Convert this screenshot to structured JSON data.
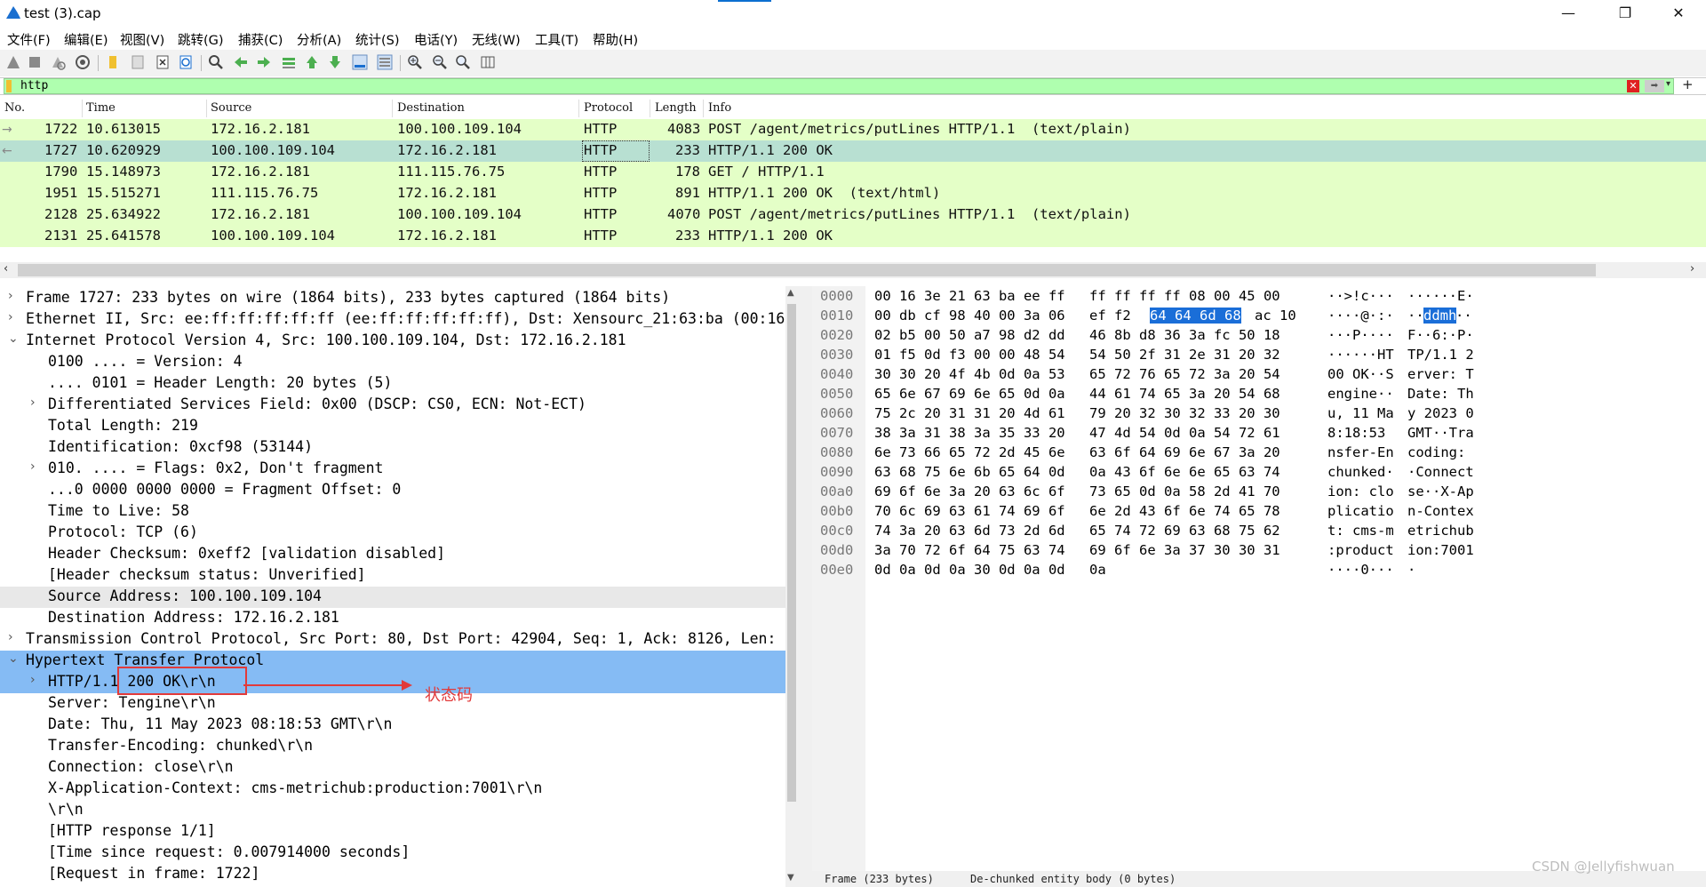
{
  "window": {
    "title": "test (3).cap",
    "minimize": "—",
    "restore": "❐",
    "close": "✕"
  },
  "menu": [
    "文件(F)",
    "编辑(E)",
    "视图(V)",
    "跳转(G)",
    "捕获(C)",
    "分析(A)",
    "统计(S)",
    "电话(Y)",
    "无线(W)",
    "工具(T)",
    "帮助(H)"
  ],
  "filter": {
    "value": "http"
  },
  "packet_list": {
    "columns": [
      "No.",
      "Time",
      "Source",
      "Destination",
      "Protocol",
      "Length",
      "Info"
    ],
    "rows": [
      {
        "no": "1722",
        "time": "10.613015",
        "src": "172.16.2.181",
        "dst": "100.100.109.104",
        "proto": "HTTP",
        "len": "4083",
        "info": "POST /agent/metrics/putLines HTTP/1.1  (text/plain)"
      },
      {
        "no": "1727",
        "time": "10.620929",
        "src": "100.100.109.104",
        "dst": "172.16.2.181",
        "proto": "HTTP",
        "len": "233",
        "info": "HTTP/1.1 200 OK"
      },
      {
        "no": "1790",
        "time": "15.148973",
        "src": "172.16.2.181",
        "dst": "111.115.76.75",
        "proto": "HTTP",
        "len": "178",
        "info": "GET / HTTP/1.1"
      },
      {
        "no": "1951",
        "time": "15.515271",
        "src": "111.115.76.75",
        "dst": "172.16.2.181",
        "proto": "HTTP",
        "len": "891",
        "info": "HTTP/1.1 200 OK  (text/html)"
      },
      {
        "no": "2128",
        "time": "25.634922",
        "src": "172.16.2.181",
        "dst": "100.100.109.104",
        "proto": "HTTP",
        "len": "4070",
        "info": "POST /agent/metrics/putLines HTTP/1.1  (text/plain)"
      },
      {
        "no": "2131",
        "time": "25.641578",
        "src": "100.100.109.104",
        "dst": "172.16.2.181",
        "proto": "HTTP",
        "len": "233",
        "info": "HTTP/1.1 200 OK"
      }
    ]
  },
  "details": [
    {
      "text": "Frame 1727: 233 bytes on wire (1864 bits), 233 bytes captured (1864 bits)",
      "exp": "›",
      "indent": 0
    },
    {
      "text": "Ethernet II, Src: ee:ff:ff:ff:ff:ff (ee:ff:ff:ff:ff:ff), Dst: Xensourc_21:63:ba (00:16",
      "exp": "›",
      "indent": 0
    },
    {
      "text": "Internet Protocol Version 4, Src: 100.100.109.104, Dst: 172.16.2.181",
      "exp": "⌄",
      "indent": 0
    },
    {
      "text": "0100 .... = Version: 4",
      "exp": "",
      "indent": 1
    },
    {
      "text": ".... 0101 = Header Length: 20 bytes (5)",
      "exp": "",
      "indent": 1
    },
    {
      "text": "Differentiated Services Field: 0x00 (DSCP: CS0, ECN: Not-ECT)",
      "exp": "›",
      "indent": 1
    },
    {
      "text": "Total Length: 219",
      "exp": "",
      "indent": 1
    },
    {
      "text": "Identification: 0xcf98 (53144)",
      "exp": "",
      "indent": 1
    },
    {
      "text": "010. .... = Flags: 0x2, Don't fragment",
      "exp": "›",
      "indent": 1
    },
    {
      "text": "...0 0000 0000 0000 = Fragment Offset: 0",
      "exp": "",
      "indent": 1
    },
    {
      "text": "Time to Live: 58",
      "exp": "",
      "indent": 1
    },
    {
      "text": "Protocol: TCP (6)",
      "exp": "",
      "indent": 1
    },
    {
      "text": "Header Checksum: 0xeff2 [validation disabled]",
      "exp": "",
      "indent": 1
    },
    {
      "text": "[Header checksum status: Unverified]",
      "exp": "",
      "indent": 1
    },
    {
      "text": "Source Address: 100.100.109.104",
      "exp": "",
      "indent": 1
    },
    {
      "text": "Destination Address: 172.16.2.181",
      "exp": "",
      "indent": 1
    },
    {
      "text": "Transmission Control Protocol, Src Port: 80, Dst Port: 42904, Seq: 1, Ack: 8126, Len:",
      "exp": "›",
      "indent": 0
    },
    {
      "text": "Hypertext Transfer Protocol",
      "exp": "⌄",
      "indent": 0
    },
    {
      "text": "HTTP/1.1 200 OK\\r\\n",
      "exp": "›",
      "indent": 1
    },
    {
      "text": "Server: Tengine\\r\\n",
      "exp": "",
      "indent": 1
    },
    {
      "text": "Date: Thu, 11 May 2023 08:18:53 GMT\\r\\n",
      "exp": "",
      "indent": 1
    },
    {
      "text": "Transfer-Encoding: chunked\\r\\n",
      "exp": "",
      "indent": 1
    },
    {
      "text": "Connection: close\\r\\n",
      "exp": "",
      "indent": 1
    },
    {
      "text": "X-Application-Context: cms-metrichub:production:7001\\r\\n",
      "exp": "",
      "indent": 1
    },
    {
      "text": "\\r\\n",
      "exp": "",
      "indent": 1
    },
    {
      "text": "[HTTP response 1/1]",
      "exp": "",
      "indent": 1
    },
    {
      "text": "[Time since request: 0.007914000 seconds]",
      "exp": "",
      "indent": 1
    },
    {
      "text": "[Request in frame: 1722]",
      "exp": "",
      "indent": 1
    }
  ],
  "hex": [
    {
      "off": "0000",
      "b1": "00 16 3e 21 63 ba ee ff",
      "b2": "ff ff ff ff 08 00 45 00",
      "a1": "··>!c···",
      "a2": "······E·"
    },
    {
      "off": "0010",
      "b1": "00 db cf 98 40 00 3a 06",
      "b2": "ef f2",
      "b2sel": "64 64 6d 68",
      "b2rest": "ac 10",
      "a1": "····@·:·",
      "a2": "··",
      "a2sel": "ddmh",
      "a2rest": "··"
    },
    {
      "off": "0020",
      "b1": "02 b5 00 50 a7 98 d2 dd",
      "b2": "46 8b d8 36 3a fc 50 18",
      "a1": "···P····",
      "a2": "F··6:·P·"
    },
    {
      "off": "0030",
      "b1": "01 f5 0d f3 00 00 48 54",
      "b2": "54 50 2f 31 2e 31 20 32",
      "a1": "······HT",
      "a2": "TP/1.1 2"
    },
    {
      "off": "0040",
      "b1": "30 30 20 4f 4b 0d 0a 53",
      "b2": "65 72 76 65 72 3a 20 54",
      "a1": "00 OK··S",
      "a2": "erver: T"
    },
    {
      "off": "0050",
      "b1": "65 6e 67 69 6e 65 0d 0a",
      "b2": "44 61 74 65 3a 20 54 68",
      "a1": "engine··",
      "a2": "Date: Th"
    },
    {
      "off": "0060",
      "b1": "75 2c 20 31 31 20 4d 61",
      "b2": "79 20 32 30 32 33 20 30",
      "a1": "u, 11 Ma",
      "a2": "y 2023 0"
    },
    {
      "off": "0070",
      "b1": "38 3a 31 38 3a 35 33 20",
      "b2": "47 4d 54 0d 0a 54 72 61",
      "a1": "8:18:53 ",
      "a2": "GMT··Tra"
    },
    {
      "off": "0080",
      "b1": "6e 73 66 65 72 2d 45 6e",
      "b2": "63 6f 64 69 6e 67 3a 20",
      "a1": "nsfer-En",
      "a2": "coding: "
    },
    {
      "off": "0090",
      "b1": "63 68 75 6e 6b 65 64 0d",
      "b2": "0a 43 6f 6e 6e 65 63 74",
      "a1": "chunked·",
      "a2": "·Connect"
    },
    {
      "off": "00a0",
      "b1": "69 6f 6e 3a 20 63 6c 6f",
      "b2": "73 65 0d 0a 58 2d 41 70",
      "a1": "ion: clo",
      "a2": "se··X-Ap"
    },
    {
      "off": "00b0",
      "b1": "70 6c 69 63 61 74 69 6f",
      "b2": "6e 2d 43 6f 6e 74 65 78",
      "a1": "plicatio",
      "a2": "n-Contex"
    },
    {
      "off": "00c0",
      "b1": "74 3a 20 63 6d 73 2d 6d",
      "b2": "65 74 72 69 63 68 75 62",
      "a1": "t: cms-m",
      "a2": "etrichub"
    },
    {
      "off": "00d0",
      "b1": "3a 70 72 6f 64 75 63 74",
      "b2": "69 6f 6e 3a 37 30 30 31",
      "a1": ":product",
      "a2": "ion:7001"
    },
    {
      "off": "00e0",
      "b1": "0d 0a 0d 0a 30 0d 0a 0d",
      "b2": "0a",
      "a1": "····0···",
      "a2": "·"
    }
  ],
  "status": {
    "tab1": "Frame (233 bytes)",
    "tab2": "De-chunked entity body (0 bytes)"
  },
  "annotation": {
    "label": "状态码"
  },
  "watermark": "CSDN @Jellyfishwuan",
  "colors": {
    "http_row": "#e4ffc7",
    "selected_row": "#b8e0d2",
    "filter_ok": "#afffaf",
    "highlight": "#85bbf4",
    "hex_select": "#1a6ed8",
    "annotation": "#e23a3a"
  }
}
